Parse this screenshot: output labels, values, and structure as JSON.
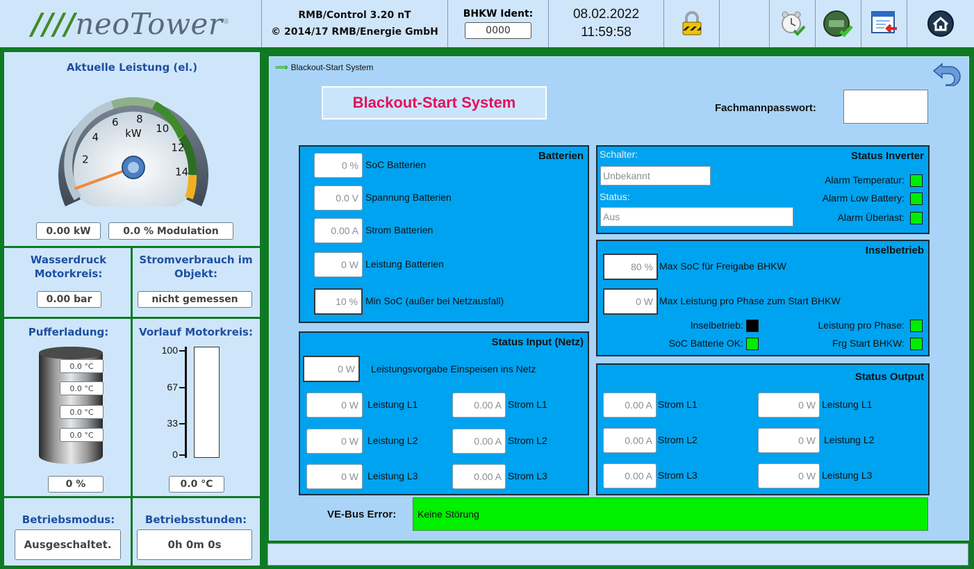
{
  "header": {
    "logo_text": "neoTower",
    "version_line1": "RMB/Control 3.20 nT",
    "version_line2": "© 2014/17 RMB/Energie GmbH",
    "ident_label": "BHKW Ident:",
    "ident_value": "0000",
    "date": "08.02.2022",
    "time": "11:59:58",
    "icons": [
      "lock-icon",
      "alarm-clock-check-icon",
      "engine-check-icon",
      "exit-window-icon",
      "home-icon"
    ]
  },
  "left": {
    "power_title": "Aktuelle Leistung (el.)",
    "gauge": {
      "unit": "kW",
      "ticks": [
        "2",
        "4",
        "6",
        "8",
        "10",
        "12",
        "14"
      ],
      "value_kw": 0.0,
      "min": 0,
      "max": 15
    },
    "power_value": "0.00 kW",
    "modulation_value": "0.0 % Modulation",
    "water_pressure_title": "Wasserdruck Motorkreis:",
    "water_pressure_value": "0.00 bar",
    "consumption_title": "Stromverbrauch im Objekt:",
    "consumption_value": "nicht gemessen",
    "buffer_title": "Pufferladung:",
    "buffer_temps": [
      "0.0 °C",
      "0.0 °C",
      "0.0 °C",
      "0.0 °C"
    ],
    "buffer_value": "0 %",
    "flow_title": "Vorlauf Motorkreis:",
    "flow_ticks": [
      "100",
      "67",
      "33",
      "0"
    ],
    "flow_value": "0.0 °C",
    "flow_level_pct": 0,
    "mode_title": "Betriebsmodus:",
    "mode_value": "Ausgeschaltet.",
    "hours_title": "Betriebsstunden:",
    "hours_value": "0h 0m 0s"
  },
  "main": {
    "breadcrumb": "Blackout-Start System",
    "page_title": "Blackout-Start System",
    "password_label": "Fachmannpasswort:",
    "password_value": "",
    "batterien": {
      "title": "Batterien",
      "rows": [
        {
          "value": "0 %",
          "label": "SoC Batterien"
        },
        {
          "value": "0.0 V",
          "label": "Spannung Batterien"
        },
        {
          "value": "0.00 A",
          "label": "Strom Batterien"
        },
        {
          "value": "0 W",
          "label": "Leistung Batterien"
        },
        {
          "value": "10 %",
          "label": "Min SoC (außer bei Netzausfall)"
        }
      ]
    },
    "status_input": {
      "title": "Status Input (Netz)",
      "feed_value": "0 W",
      "feed_label": "Leistungsvorgabe Einspeisen ins Netz",
      "rows": [
        {
          "p_value": "0 W",
          "p_label": "Leistung L1",
          "i_value": "0.00 A",
          "i_label": "Strom L1"
        },
        {
          "p_value": "0 W",
          "p_label": "Leistung L2",
          "i_value": "0.00 A",
          "i_label": "Strom L2"
        },
        {
          "p_value": "0 W",
          "p_label": "Leistung L3",
          "i_value": "0.00 A",
          "i_label": "Strom L3"
        }
      ]
    },
    "status_inverter": {
      "title": "Status Inverter",
      "switch_label": "Schalter:",
      "switch_value": "Unbekannt",
      "status_label": "Status:",
      "status_value": "Aus",
      "alarm_temp": "Alarm Temperatur:",
      "alarm_low_batt": "Alarm Low Battery:",
      "alarm_overload": "Alarm Überlast:",
      "led_color": "#00ee00"
    },
    "inselbetrieb": {
      "title": "Inselbetrieb",
      "max_soc_value": "80 %",
      "max_soc_label": "Max SoC für Freigabe BHKW",
      "max_power_value": "0 W",
      "max_power_label": "Max Leistung pro Phase zum Start BHKW",
      "island_label": "Inselbetrieb:",
      "soc_ok_label": "SoC Batterie OK:",
      "power_phase_label": "Leistung pro Phase:",
      "frg_start_label": "Frg Start BHKW:"
    },
    "status_output": {
      "title": "Status Output",
      "rows": [
        {
          "i_value": "0.00 A",
          "i_label": "Strom L1",
          "p_value": "0 W",
          "p_label": "Leistung L1"
        },
        {
          "i_value": "0.00 A",
          "i_label": "Strom L2",
          "p_value": "0 W",
          "p_label": "Leistung L2"
        },
        {
          "i_value": "0.00 A",
          "i_label": "Strom L3",
          "p_value": "0 W",
          "p_label": "Leistung L3"
        }
      ]
    },
    "vebus_label": "VE-Bus Error:",
    "vebus_value": "Keine Störung"
  }
}
